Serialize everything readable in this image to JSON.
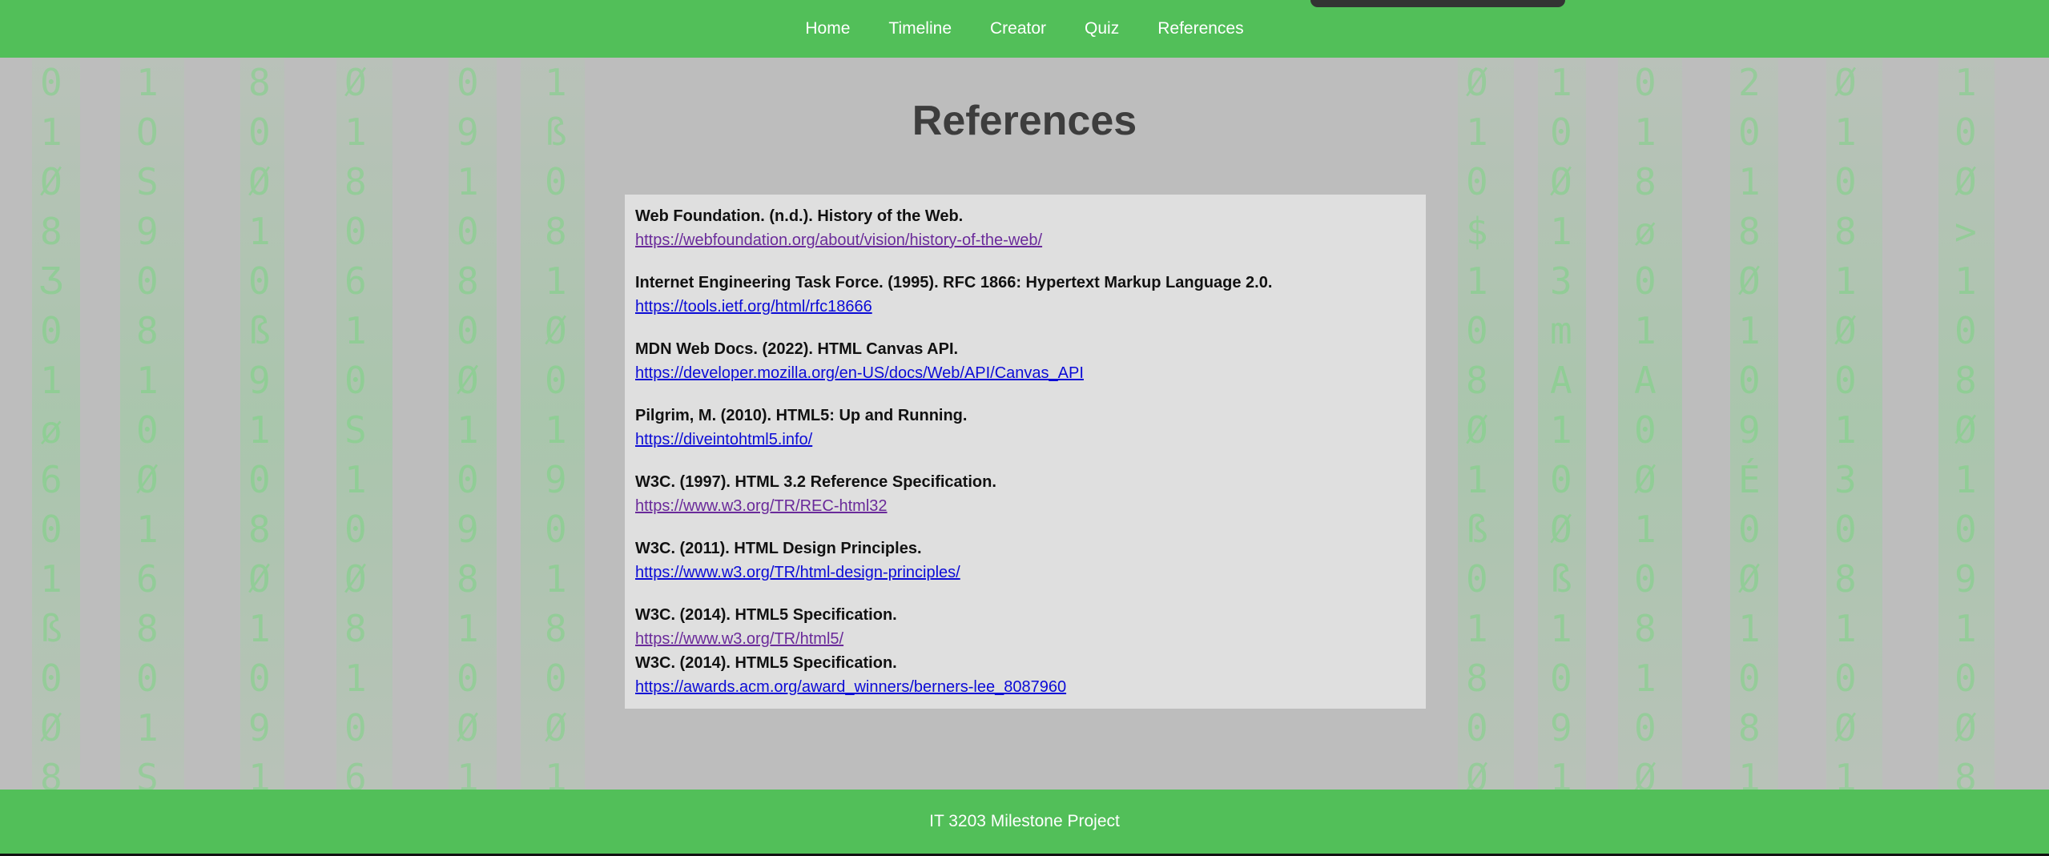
{
  "nav": {
    "items": [
      {
        "label": "Home"
      },
      {
        "label": "Timeline"
      },
      {
        "label": "Creator"
      },
      {
        "label": "Quiz"
      },
      {
        "label": "References"
      }
    ]
  },
  "main": {
    "title": "References",
    "references": [
      {
        "title": "Web Foundation. (n.d.). History of the Web.",
        "url": "https://webfoundation.org/about/vision/history-of-the-web/",
        "visited": true
      },
      {
        "title": "Internet Engineering Task Force. (1995). RFC 1866: Hypertext Markup Language 2.0.",
        "url": "https://tools.ietf.org/html/rfc18666",
        "visited": false
      },
      {
        "title": "MDN Web Docs. (2022). HTML Canvas API.",
        "url": "https://developer.mozilla.org/en-US/docs/Web/API/Canvas_API",
        "visited": false
      },
      {
        "title": "Pilgrim, M. (2010). HTML5: Up and Running.",
        "url": "https://diveintohtml5.info/",
        "visited": false
      },
      {
        "title": "W3C. (1997). HTML 3.2 Reference Specification.",
        "url": "https://www.w3.org/TR/REC-html32",
        "visited": true
      },
      {
        "title": "W3C. (2011). HTML Design Principles.",
        "url": "https://www.w3.org/TR/html-design-principles/",
        "visited": false
      },
      {
        "title": "W3C. (2014). HTML5 Specification.",
        "url": "https://www.w3.org/TR/html5/",
        "visited": true
      },
      {
        "title": "W3C. (2014). HTML5 Specification.",
        "url": "https://awards.acm.org/award_winners/berners-lee_8087960",
        "visited": false
      }
    ]
  },
  "footer": {
    "text": "IT 3203 Milestone Project"
  },
  "colors": {
    "brand_green": "#52bf59",
    "link": "#0b0bd6",
    "link_visited": "#6a2a9a"
  }
}
